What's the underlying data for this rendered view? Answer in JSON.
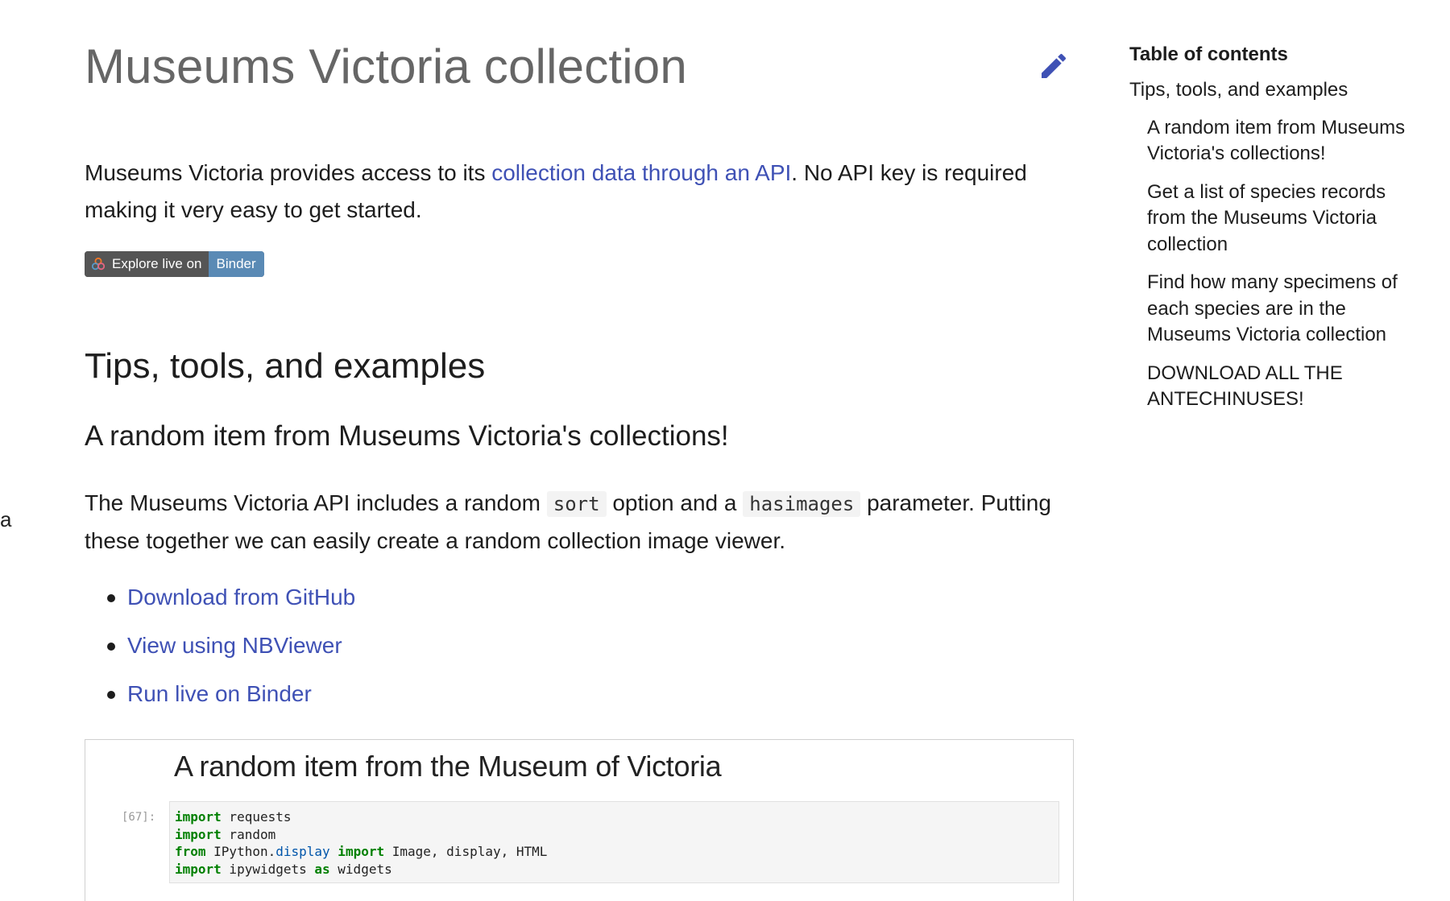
{
  "page": {
    "title": "Museums Victoria collection",
    "stray_text": "a"
  },
  "intro": {
    "before": "Museums Victoria provides access to its ",
    "link": "collection data through an API",
    "after": ". No API key is required making it very easy to get started."
  },
  "badge": {
    "left_label": "Explore live on",
    "right_label": "Binder"
  },
  "section": {
    "heading": "Tips, tools, and examples",
    "subheading": "A random item from Museums Victoria's collections!",
    "para_1": "The Museums Victoria API includes a random ",
    "code_1": "sort",
    "para_2": " option and a ",
    "code_2": "hasimages",
    "para_3": " parameter. Putting these together we can easily create a random collection image viewer.",
    "links": [
      {
        "label": "Download from GitHub"
      },
      {
        "label": "View using NBViewer"
      },
      {
        "label": "Run live on Binder"
      }
    ]
  },
  "notebook": {
    "title": "A random item from the Museum of Victoria",
    "prompt": "[67]:",
    "lines": [
      {
        "kw1": "import",
        "t1": " requests"
      },
      {
        "kw1": "import",
        "t1": " random"
      },
      {
        "kw1": "from",
        "t1": " IPython.",
        "mod": "display",
        "kw2": " import",
        "t2": " Image, display, HTML"
      },
      {
        "kw1": "import",
        "t1": " ipywidgets ",
        "kw2": "as",
        "t2": " widgets"
      }
    ]
  },
  "toc": {
    "heading": "Table of contents",
    "items": [
      {
        "label": "Tips, tools, and examples"
      },
      {
        "label": "A random item from Museums Victoria's collections!"
      },
      {
        "label": "Get a list of species records from the Museums Victoria collection"
      },
      {
        "label": "Find how many specimens of each species are in the Museums Victoria collection"
      },
      {
        "label": "DOWNLOAD ALL THE ANTECHINUSES!"
      }
    ]
  },
  "colors": {
    "link": "#3f51b5",
    "edit_icon": "#3f51b5",
    "badge_left": "#555555",
    "badge_right": "#5a8ab5"
  },
  "icons": {
    "edit": "pencil-icon",
    "binder": "binder-logo-icon"
  }
}
